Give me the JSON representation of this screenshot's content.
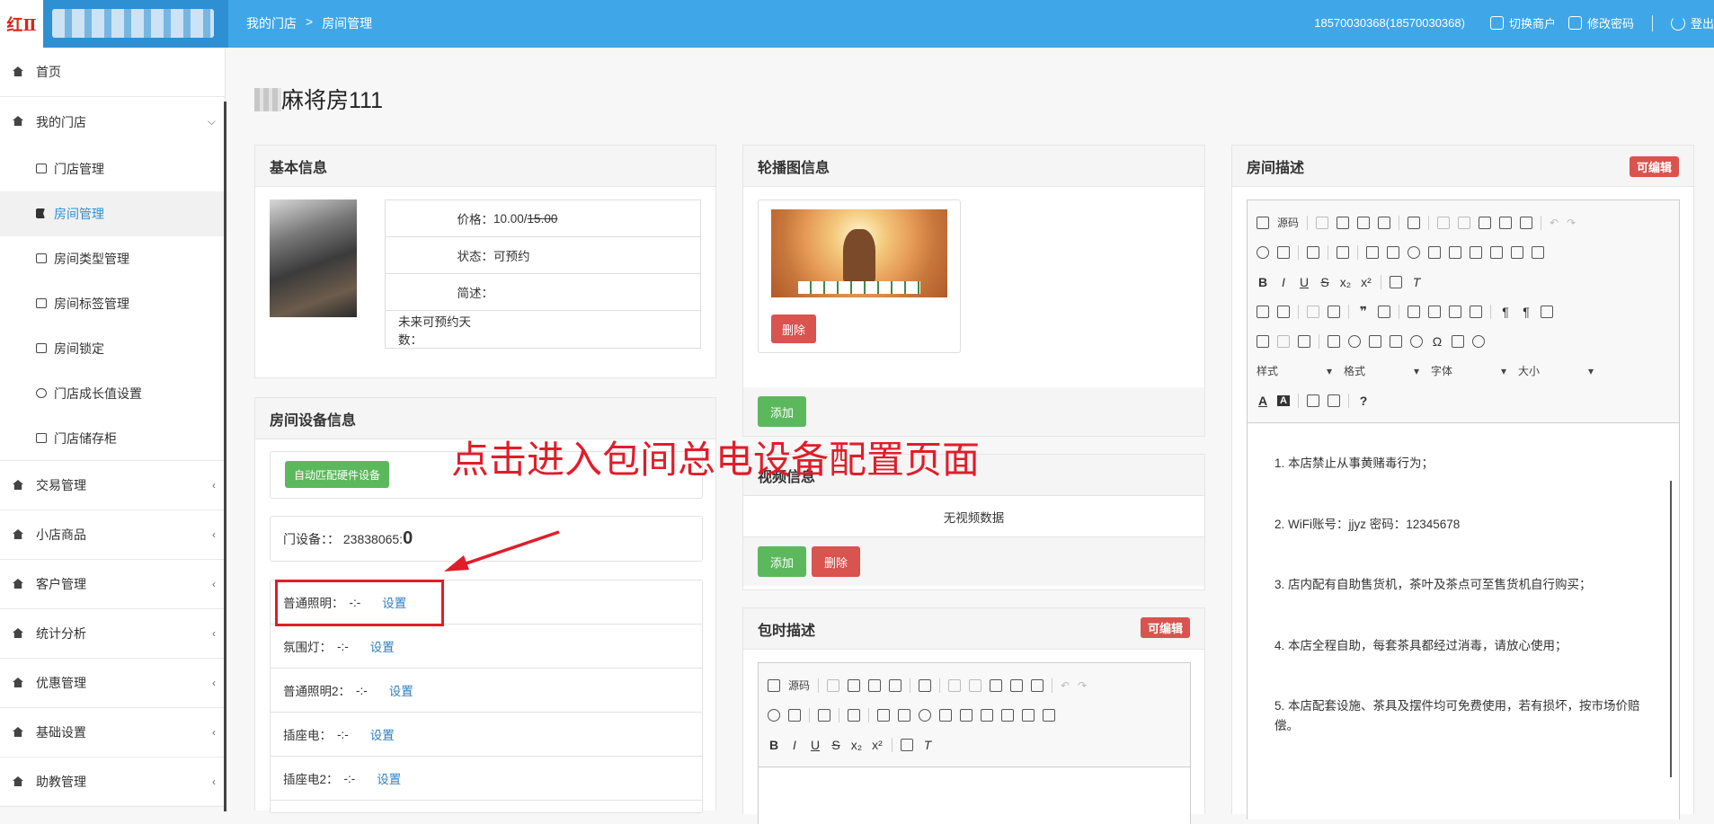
{
  "header": {
    "logo_mark": "红Ⅱ",
    "breadcrumb": [
      "我的门店",
      ">",
      "房间管理"
    ],
    "account": "18570030368(18570030368)",
    "switch_merchant": "切换商户",
    "change_password": "修改密码",
    "logout": "登出"
  },
  "sidebar": {
    "items": [
      {
        "label": "首页",
        "icon": "home-icon"
      },
      {
        "label": "我的门店",
        "icon": "home-icon",
        "expanded": true
      },
      {
        "label": "交易管理",
        "icon": "exchange-icon"
      },
      {
        "label": "小店商品",
        "icon": "gift-icon"
      },
      {
        "label": "客户管理",
        "icon": "user-icon"
      },
      {
        "label": "统计分析",
        "icon": "gear-icon"
      },
      {
        "label": "优惠管理",
        "icon": "tag-icon"
      },
      {
        "label": "基础设置",
        "icon": "barcode-icon"
      },
      {
        "label": "助教管理",
        "icon": "user-icon"
      }
    ],
    "store_sub": [
      {
        "label": "门店管理",
        "icon": "inbox-icon"
      },
      {
        "label": "房间管理",
        "icon": "flag-icon",
        "active": true
      },
      {
        "label": "房间类型管理",
        "icon": "list-icon"
      },
      {
        "label": "房间标签管理",
        "icon": "bookmark-icon"
      },
      {
        "label": "房间锁定",
        "icon": "lock-icon"
      },
      {
        "label": "门店成长值设置",
        "icon": "cog-icon"
      },
      {
        "label": "门店储存柜",
        "icon": "inbox-icon"
      }
    ]
  },
  "page": {
    "title": "麻将房111"
  },
  "basic_info": {
    "heading": "基本信息",
    "price_label": "价格：",
    "price": "10.00/",
    "price_original": "15.00",
    "status_label": "状态：",
    "status": "可预约",
    "brief_label": "简述：",
    "days_label": "未来可预约天数："
  },
  "devices": {
    "heading": "房间设备信息",
    "auto_match_button": "自动匹配硬件设备",
    "door_label": "门设备：：",
    "door_id": "23838065:",
    "door_value": "0",
    "rows": [
      {
        "label": "普通照明：",
        "value": "-:-",
        "link": "设置"
      },
      {
        "label": "氛围灯：",
        "value": "-:-",
        "link": "设置"
      },
      {
        "label": "普通照明2：",
        "value": "-:-",
        "link": "设置"
      },
      {
        "label": "插座电：",
        "value": "-:-",
        "link": "设置"
      },
      {
        "label": "插座电2：",
        "value": "-:-",
        "link": "设置"
      }
    ]
  },
  "carousel": {
    "heading": "轮播图信息",
    "delete_button": "删除",
    "add_button": "添加"
  },
  "video": {
    "heading": "视频信息",
    "empty_text": "无视频数据",
    "add_button": "添加",
    "delete_button": "删除"
  },
  "timed_desc": {
    "heading": "包时描述",
    "badge": "可编辑"
  },
  "room_desc": {
    "heading": "房间描述",
    "badge": "可编辑",
    "lines": [
      "1. 本店禁止从事黄赌毒行为；",
      "2. WiFi账号：jjyz 密码：12345678",
      "3. 店内配有自助售货机，茶叶及茶点可至售货机自行购买；",
      "4. 本店全程自助，每套茶具都经过消毒，请放心使用；",
      "5. 本店配套设施、茶具及摆件均可免费使用，若有损坏，按市场价赔偿。"
    ]
  },
  "editor": {
    "source_label": "源码",
    "style_label": "样式",
    "format_label": "格式",
    "font_label": "字体",
    "size_label": "大小"
  },
  "annotation": {
    "text": "点击进入包间总电设备配置页面"
  },
  "colors": {
    "header": "#3fa7e8",
    "success": "#5cb85c",
    "danger": "#d9534f",
    "annotation": "#e11d2a"
  }
}
